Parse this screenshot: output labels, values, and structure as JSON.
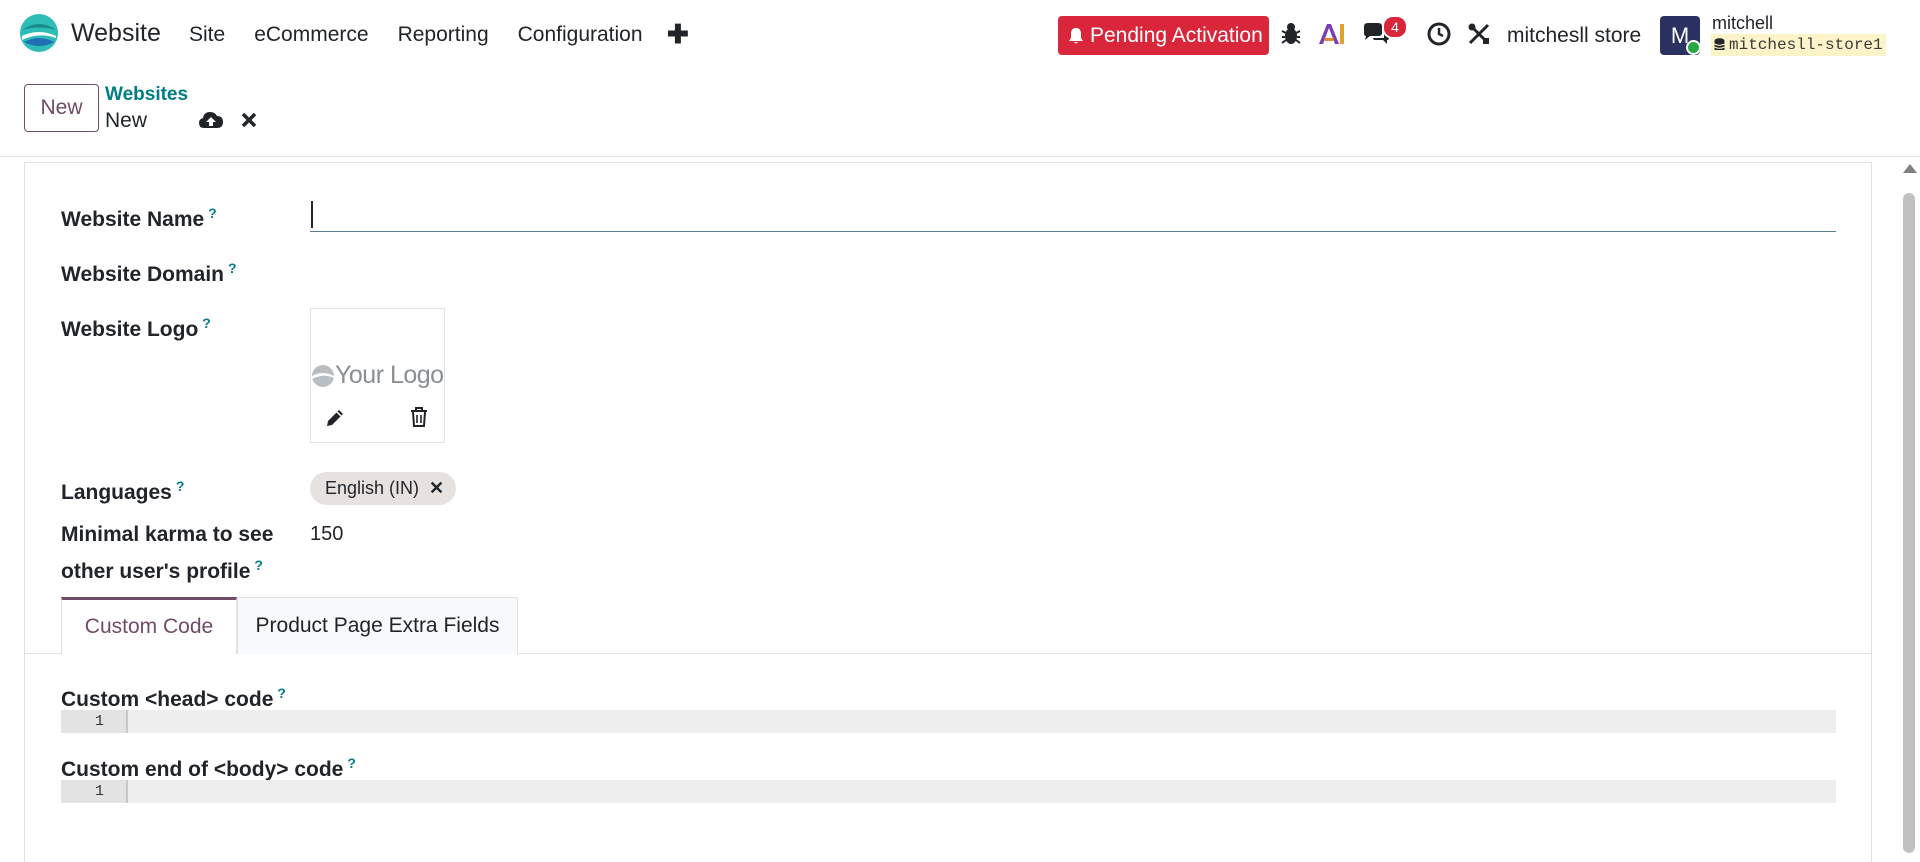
{
  "app": {
    "name": "Website"
  },
  "menu": [
    "Site",
    "eCommerce",
    "Reporting",
    "Configuration"
  ],
  "systray": {
    "pending": "Pending Activation",
    "message_count": "4",
    "company": "mitchesll store",
    "avatar_letter": "M",
    "user": "mitchell",
    "database": "mitchesll-store1"
  },
  "control": {
    "new_label": "New",
    "breadcrumb_parent": "Websites",
    "breadcrumb_current": "New"
  },
  "form": {
    "website_name_label": "Website Name",
    "website_name_value": "",
    "website_domain_label": "Website Domain",
    "website_logo_label": "Website Logo",
    "logo_placeholder": "Your Logo",
    "languages_label": "Languages",
    "language_tag": "English (IN)",
    "karma_label_line1": "Minimal karma to see",
    "karma_label_line2": "other user's profile",
    "karma_value": "150",
    "help_mark": "?"
  },
  "tabs": [
    "Custom Code",
    "Product Page Extra Fields"
  ],
  "custom_code": {
    "head_label": "Custom <head> code",
    "body_label": "Custom end of <body> code",
    "line_number": "1"
  },
  "colors": {
    "brand": "#714b67",
    "link": "#017e84",
    "danger": "#d9263b"
  }
}
